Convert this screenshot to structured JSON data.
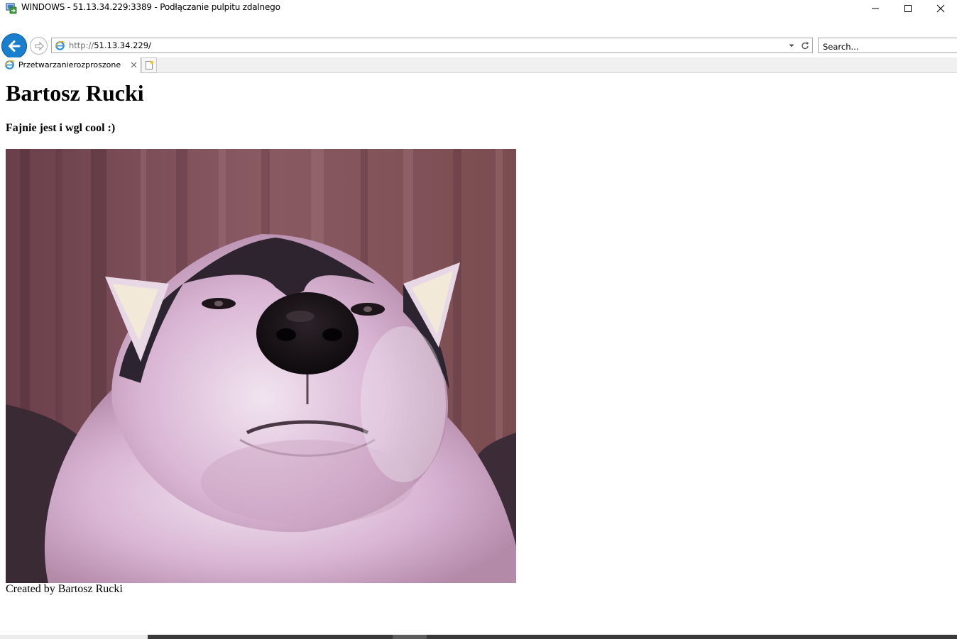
{
  "window": {
    "title": "WINDOWS - 51.13.34.229:3389 - Podłączanie pulpitu zdalnego",
    "icon": "remote-desktop-icon",
    "minimize_icon": "minimize-icon",
    "maximize_icon": "maximize-icon",
    "close_icon": "close-icon"
  },
  "browser": {
    "back_icon": "back-arrow-icon",
    "forward_icon": "forward-arrow-icon",
    "address": {
      "scheme": "http://",
      "host": "51.13.34.229/",
      "favicon": "internet-explorer-icon",
      "dropdown_icon": "chevron-down-icon",
      "refresh_icon": "refresh-icon"
    },
    "search": {
      "placeholder": "Search..."
    },
    "tabs": [
      {
        "label": "Przetwarzanierozproszone",
        "favicon": "internet-explorer-icon",
        "close_icon": "close-icon"
      }
    ],
    "new_tab_icon": "new-tab-icon",
    "accent_color": "#1a7ecf"
  },
  "page": {
    "heading": "Bartosz Rucki",
    "subheading": "Fajnie jest i wgl cool :)",
    "image": {
      "subject": "husky-dog-photo"
    },
    "footer": "Created by Bartosz Rucki"
  }
}
